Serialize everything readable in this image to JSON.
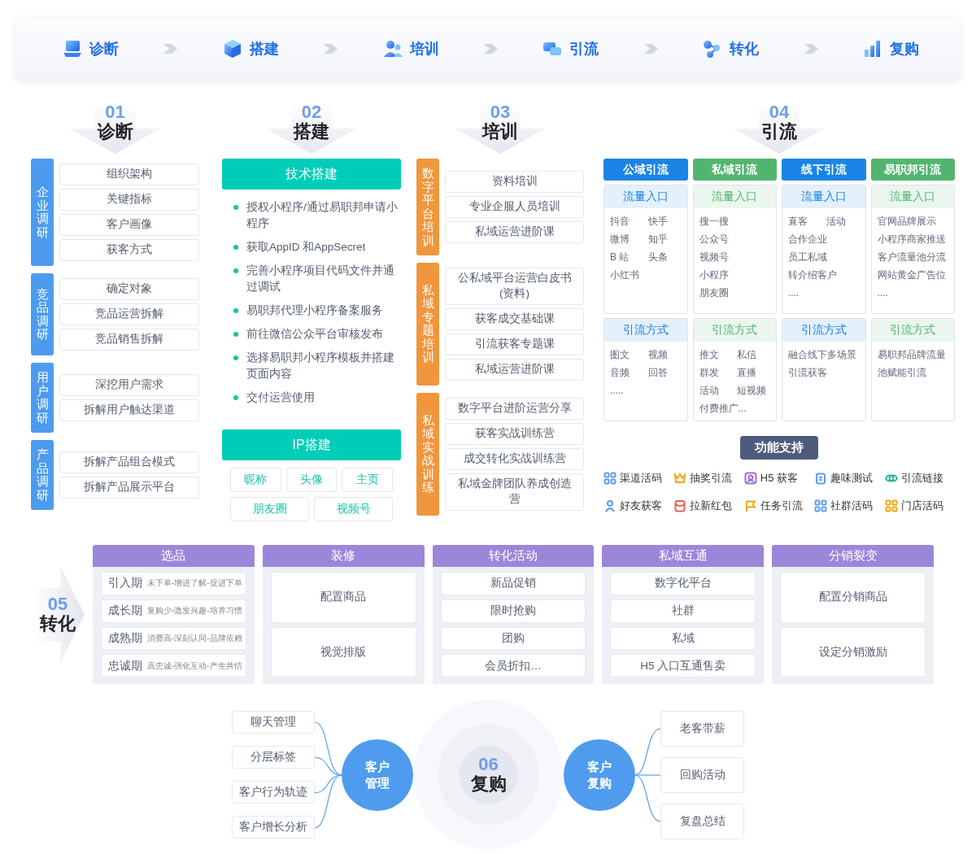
{
  "nav": {
    "steps": [
      "诊断",
      "搭建",
      "培训",
      "引流",
      "转化",
      "复购"
    ]
  },
  "diagnose": {
    "number": "01",
    "title": "诊断",
    "groups": [
      {
        "label": "企业调研",
        "items": [
          "组织架构",
          "关键指标",
          "客户画像",
          "获客方式"
        ]
      },
      {
        "label": "竞品调研",
        "items": [
          "确定对象",
          "竞品运营拆解",
          "竞品销售拆解"
        ]
      },
      {
        "label": "用户调研",
        "items": [
          "深挖用户需求",
          "拆解用户触达渠道"
        ]
      },
      {
        "label": "产品调研",
        "items": [
          "拆解产品组合模式",
          "拆解产品展示平台"
        ]
      }
    ]
  },
  "build": {
    "number": "02",
    "title": "搭建",
    "tech": {
      "title": "技术搭建",
      "bullets": [
        "授权小程序/通过易职邦申请小程序",
        "获取AppID 和AppSecret",
        "完善小程序项目代码文件并通过调试",
        "易职邦代理小程序备案服务",
        "前往微信公众平台审核发布",
        "选择易职邦小程序模板并搭建页面内容",
        "交付运营使用"
      ]
    },
    "ip": {
      "title": "IP搭建",
      "tags": [
        "昵称",
        "头像",
        "主页",
        "朋友圈",
        "视频号"
      ]
    }
  },
  "training": {
    "number": "03",
    "title": "培训",
    "groups": [
      {
        "label": "数字平台培训",
        "items": [
          "资料培训",
          "专业企服人员培训",
          "私域运营进阶课"
        ]
      },
      {
        "label": "私域专题培训",
        "items": [
          "公私域平台运营白皮书(资料)",
          "获客成交基础课",
          "引流获客专题课",
          "私域运营进阶课"
        ]
      },
      {
        "label": "私域实战训练",
        "items": [
          "数字平台进阶运营分享",
          "获客实战训练营",
          "成交转化实战训练营",
          "私域金牌团队养成创造营"
        ]
      }
    ]
  },
  "traffic": {
    "number": "04",
    "title": "引流",
    "channels": [
      {
        "title": "公域引流",
        "color": "#1a84e6",
        "entry": {
          "title": "流量入口",
          "lines": [
            [
              "抖音",
              "快手"
            ],
            [
              "微博",
              "知乎"
            ],
            [
              "B 站",
              "头条"
            ],
            [
              "小红书"
            ]
          ]
        },
        "method": {
          "title": "引流方式",
          "lines": [
            [
              "图文",
              "视频"
            ],
            [
              "音频",
              "回答"
            ],
            [
              "....."
            ]
          ]
        }
      },
      {
        "title": "私域引流",
        "color": "#52b56e",
        "entry": {
          "title": "流量入口",
          "lines": [
            [
              "搜一搜"
            ],
            [
              "公众号"
            ],
            [
              "视频号"
            ],
            [
              "小程序"
            ],
            [
              "朋友圈"
            ]
          ]
        },
        "method": {
          "title": "引流方式",
          "lines": [
            [
              "推文",
              "私信"
            ],
            [
              "群发",
              "直播"
            ],
            [
              "活动",
              "短视频"
            ],
            [
              "付费推广..."
            ]
          ]
        }
      },
      {
        "title": "线下引流",
        "color": "#1a84e6",
        "entry": {
          "title": "流量入口",
          "lines": [
            [
              "直客",
              "活动"
            ],
            [
              "合作企业"
            ],
            [
              "员工私域"
            ],
            [
              "转介绍客户"
            ],
            [
              "...."
            ]
          ]
        },
        "method": {
          "title": "引流方式",
          "lines": [
            [
              "融合线下多场景引流获客"
            ]
          ]
        }
      },
      {
        "title": "易职邦引流",
        "color": "#52b56e",
        "entry": {
          "title": "流量入口",
          "lines": [
            [
              "官网品牌展示"
            ],
            [
              "小程序商家推送"
            ],
            [
              "客户流量池分流"
            ],
            [
              "网站黄金广告位"
            ],
            [
              "...."
            ]
          ]
        },
        "method": {
          "title": "引流方式",
          "lines": [
            [
              "易职邦品牌流量池赋能引流"
            ]
          ]
        }
      }
    ],
    "support": {
      "title": "功能支持",
      "items": [
        {
          "label": "渠道活码",
          "color": "#5b9ef0"
        },
        {
          "label": "抽奖引流",
          "color": "#f2a516"
        },
        {
          "label": "H5 获客",
          "color": "#9a6fe0"
        },
        {
          "label": "趣味测试",
          "color": "#5b9ef0"
        },
        {
          "label": "引流链接",
          "color": "#23b39a"
        },
        {
          "label": "好友获客",
          "color": "#5b9ef0"
        },
        {
          "label": "拉新红包",
          "color": "#ef5b5b"
        },
        {
          "label": "任务引流",
          "color": "#f2a516"
        },
        {
          "label": "社群活码",
          "color": "#5b9ef0"
        },
        {
          "label": "门店活码",
          "color": "#f2a516"
        }
      ]
    }
  },
  "conversion": {
    "number": "05",
    "title": "转化",
    "columns": [
      {
        "title": "选品",
        "items": [
          {
            "label": "引入期",
            "note": "未下单-增进了解-促进下单"
          },
          {
            "label": "成长期",
            "note": "复购少-激发兴趣-培养习惯"
          },
          {
            "label": "成熟期",
            "note": "消费高-深刻认同-品牌依赖"
          },
          {
            "label": "忠诚期",
            "note": "高忠诚-强化互动-产生共情"
          }
        ]
      },
      {
        "title": "装修",
        "items": [
          {
            "label": "配置商品"
          },
          {
            "label": "视觉排版"
          }
        ]
      },
      {
        "title": "转化活动",
        "items": [
          {
            "label": "新品促销"
          },
          {
            "label": "限时抢购"
          },
          {
            "label": "团购"
          },
          {
            "label": "会员折扣…"
          }
        ]
      },
      {
        "title": "私域互通",
        "items": [
          {
            "label": "数字化平台"
          },
          {
            "label": "社群"
          },
          {
            "label": "私域"
          },
          {
            "label": "H5 入口互通售卖"
          }
        ]
      },
      {
        "title": "分销裂变",
        "items": [
          {
            "label": "配置分销商品"
          },
          {
            "label": "设定分销激励"
          }
        ]
      }
    ]
  },
  "repurchase": {
    "number": "06",
    "title": "复购",
    "left": {
      "title": "客户管理",
      "items": [
        "聊天管理",
        "分层标签",
        "客户行为轨迹",
        "客户增长分析"
      ]
    },
    "right": {
      "title": "客户复购",
      "items": [
        "老客带薪",
        "回购活动",
        "复盘总结"
      ]
    }
  }
}
